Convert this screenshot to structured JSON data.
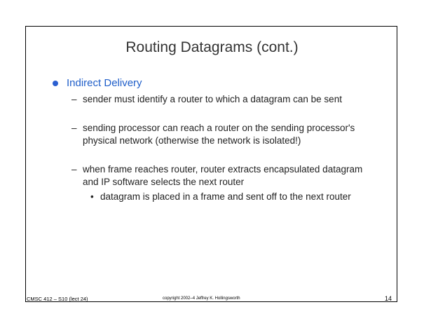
{
  "slide": {
    "title": "Routing Datagrams (cont.)",
    "heading": "Indirect Delivery",
    "points": [
      "sender must identify a router to which a datagram can be sent",
      "sending processor can reach a router on the sending processor's physical network (otherwise the network is isolated!)",
      "when frame reaches router, router extracts encapsulated datagram and IP software selects the next router"
    ],
    "subpoint": "datagram is placed in a frame and sent off to the next router",
    "dash_glyph": "–",
    "dot_glyph": "•"
  },
  "footer": {
    "course": "CMSC 412 – S10 (lect 24)",
    "copyright": "copyright 2002–4 Jeffrey K. Hollingsworth",
    "page_number": "14"
  },
  "colors": {
    "heading": "#1f5ec9",
    "bullet": "#2b5fd1",
    "text": "#222222"
  }
}
